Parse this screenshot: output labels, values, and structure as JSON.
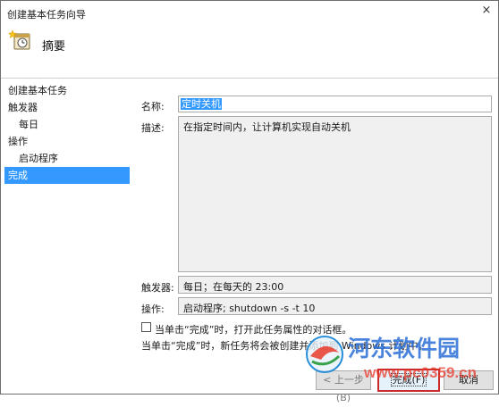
{
  "window": {
    "title": "创建基本任务向导",
    "close_glyph": "×"
  },
  "header": {
    "title": "摘要",
    "icon": "clock-task-icon"
  },
  "sidebar": {
    "items": [
      {
        "label": "创建基本任务"
      },
      {
        "label": "触发器"
      },
      {
        "label": "每日"
      },
      {
        "label": "操作"
      },
      {
        "label": "启动程序"
      },
      {
        "label": "完成"
      }
    ]
  },
  "form": {
    "name_label": "名称:",
    "name_value": "定时关机",
    "desc_label": "描述:",
    "desc_value": "在指定时间内，让计算机实现自动关机",
    "trigger_label": "触发器:",
    "trigger_value": "每日；在每天的 23:00",
    "action_label": "操作:",
    "action_value": "启动程序; shutdown -s -t 10",
    "checkbox_label": "当单击“完成”时，打开此任务属性的对话框。",
    "note": "当单击“完成”时，新任务将会被创建并添加到 Windows 计划中。"
  },
  "buttons": {
    "back": "< 上一步(B)",
    "finish": "完成(F)",
    "cancel": "取消"
  },
  "watermark": {
    "text": "河东软件园",
    "url_text": "www.pc0359.cn"
  },
  "colors": {
    "selection": "#3399ff",
    "highlight_border": "#cc2a2a"
  }
}
